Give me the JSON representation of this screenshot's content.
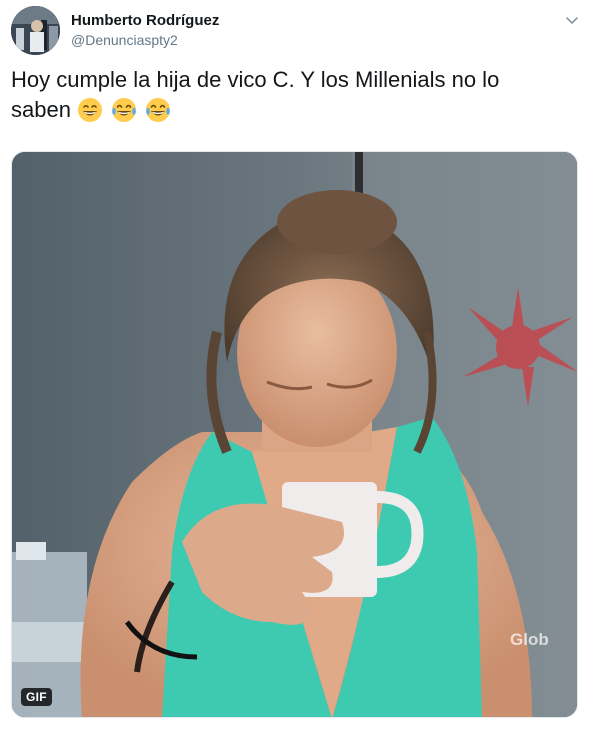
{
  "tweet": {
    "author": {
      "display_name": "Humberto Rodríguez",
      "handle": "@Denunciaspty2"
    },
    "text_line": "Hoy cumple la hija de vico C. Y los Millenials no lo",
    "text_line2": "saben",
    "emojis": [
      "grinning-face-with-smiling-eyes",
      "face-with-tears-of-joy",
      "face-with-tears-of-joy"
    ],
    "media": {
      "type": "gif",
      "badge": "GIF",
      "watermark": "Glob"
    },
    "menu_icon": "chevron-down-icon"
  },
  "colors": {
    "text_primary": "#14171a",
    "text_secondary": "#657786",
    "border": "#e1e8ed",
    "top_color": "#3ec9b1"
  }
}
